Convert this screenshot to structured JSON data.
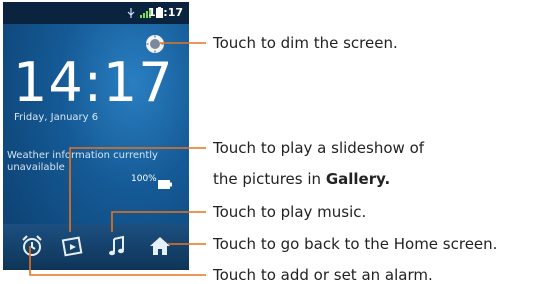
{
  "phone": {
    "status_time": "14:17",
    "clock_time": "14:17",
    "date": "Friday, January 6",
    "weather": "Weather information currently unavailable",
    "battery_percent": "100%"
  },
  "callouts": {
    "dim": "Touch to dim the screen.",
    "slideshow_line1": "Touch to play a slideshow of",
    "slideshow_line2_prefix": "the pictures in",
    "slideshow_gallery": "Gallery.",
    "music": "Touch to play music.",
    "home": "Touch to go back to the Home screen.",
    "alarm": "Touch to add or set an alarm."
  },
  "colors": {
    "callout_line": "#e8741e",
    "screen_blue": "#155a96"
  },
  "icons": [
    "brightness-icon",
    "alarm-icon",
    "slideshow-icon",
    "music-icon",
    "home-icon"
  ]
}
